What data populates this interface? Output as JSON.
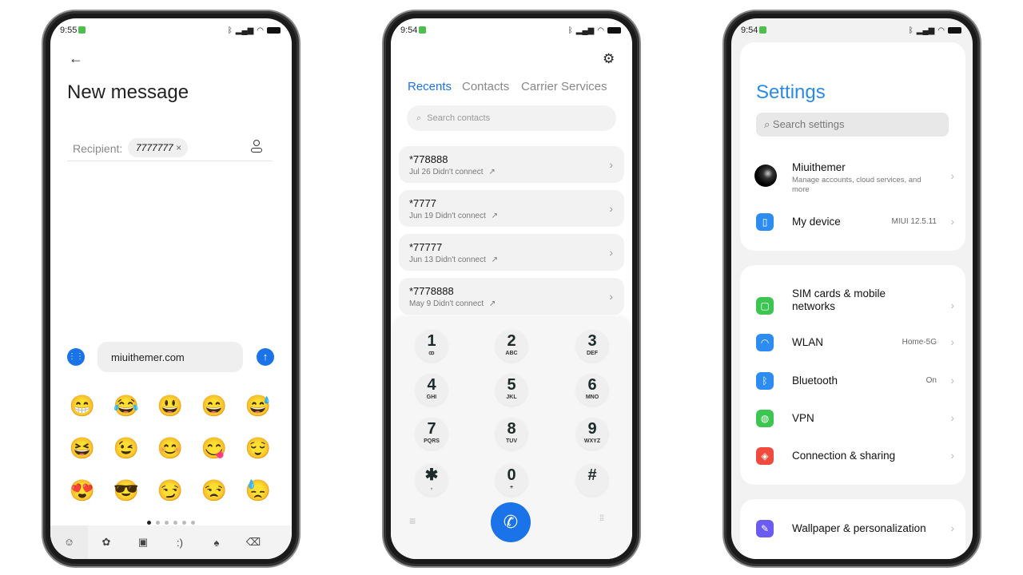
{
  "phone1": {
    "time": "9:55",
    "title": "New message",
    "recipient_label": "Recipient:",
    "recipient_chip": "7777777",
    "message_input": "miuithemer.com",
    "emojis": [
      "😁",
      "😂",
      "😃",
      "😄",
      "😅",
      "😆",
      "😉",
      "😊",
      "😋",
      "😌",
      "😍",
      "😎",
      "😏",
      "😒",
      "😓"
    ],
    "keyboard_tabs": [
      "smiley-icon",
      "flower-icon",
      "tv-icon",
      ":)",
      "spade-icon",
      "backspace-icon"
    ],
    "emoticon_tab": ":)"
  },
  "phone2": {
    "time": "9:54",
    "tabs": [
      "Recents",
      "Contacts",
      "Carrier Services"
    ],
    "search_placeholder": "Search contacts",
    "recents": [
      {
        "number": "*778888",
        "detail": "Jul 26 Didn't connect"
      },
      {
        "number": "*7777",
        "detail": "Jun 19 Didn't connect"
      },
      {
        "number": "*77777",
        "detail": "Jun 13 Didn't connect"
      },
      {
        "number": "*7778888",
        "detail": "May 9 Didn't connect"
      }
    ],
    "keys": [
      {
        "d": "1",
        "l": "ꝏ"
      },
      {
        "d": "2",
        "l": "ABC"
      },
      {
        "d": "3",
        "l": "DEF"
      },
      {
        "d": "4",
        "l": "GHI"
      },
      {
        "d": "5",
        "l": "JKL"
      },
      {
        "d": "6",
        "l": "MNO"
      },
      {
        "d": "7",
        "l": "PQRS"
      },
      {
        "d": "8",
        "l": "TUV"
      },
      {
        "d": "9",
        "l": "WXYZ"
      },
      {
        "d": "✱",
        "l": ","
      },
      {
        "d": "0",
        "l": "+"
      },
      {
        "d": "#",
        "l": ""
      }
    ],
    "accent": "#1a73e8"
  },
  "phone3": {
    "time": "9:54",
    "title": "Settings",
    "search_placeholder": "Search settings",
    "account": {
      "name": "Miuithemer",
      "desc": "Manage accounts, cloud services, and more"
    },
    "my_device": {
      "label": "My device",
      "value": "MIUI 12.5.11"
    },
    "items": [
      {
        "label": "SIM cards & mobile networks",
        "value": "",
        "color": "#3cc651",
        "icon": "sim-icon"
      },
      {
        "label": "WLAN",
        "value": "Home-5G",
        "color": "#2d8cf0",
        "icon": "wifi-icon"
      },
      {
        "label": "Bluetooth",
        "value": "On",
        "color": "#2d8cf0",
        "icon": "bluetooth-icon"
      },
      {
        "label": "VPN",
        "value": "",
        "color": "#3cc651",
        "icon": "globe-icon"
      },
      {
        "label": "Connection & sharing",
        "value": "",
        "color": "#f04a3e",
        "icon": "sharing-icon"
      }
    ],
    "wallpaper": {
      "label": "Wallpaper & personalization",
      "color": "#6a5cf0"
    },
    "accent": "#2a8ae6"
  }
}
